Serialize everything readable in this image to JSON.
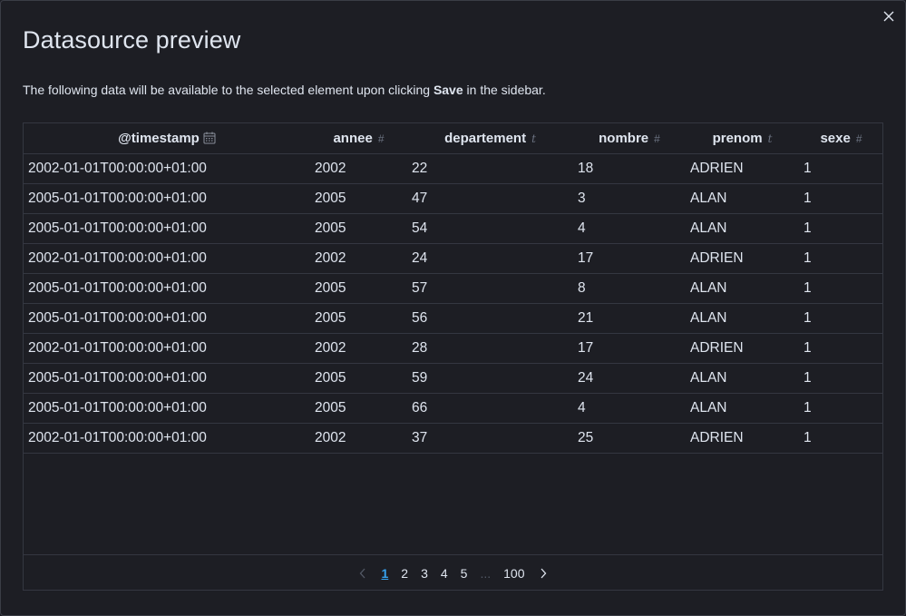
{
  "modal": {
    "title": "Datasource preview",
    "desc_before": "The following data will be available to the selected element upon clicking ",
    "desc_bold": "Save",
    "desc_after": " in the sidebar."
  },
  "table": {
    "columns": [
      {
        "label": "@timestamp",
        "type": "date"
      },
      {
        "label": "annee",
        "type": "#"
      },
      {
        "label": "departement",
        "type": "t"
      },
      {
        "label": "nombre",
        "type": "#"
      },
      {
        "label": "prenom",
        "type": "t"
      },
      {
        "label": "sexe",
        "type": "#"
      }
    ],
    "rows": [
      [
        "2002-01-01T00:00:00+01:00",
        "2002",
        "22",
        "18",
        "ADRIEN",
        "1"
      ],
      [
        "2005-01-01T00:00:00+01:00",
        "2005",
        "47",
        "3",
        "ALAN",
        "1"
      ],
      [
        "2005-01-01T00:00:00+01:00",
        "2005",
        "54",
        "4",
        "ALAN",
        "1"
      ],
      [
        "2002-01-01T00:00:00+01:00",
        "2002",
        "24",
        "17",
        "ADRIEN",
        "1"
      ],
      [
        "2005-01-01T00:00:00+01:00",
        "2005",
        "57",
        "8",
        "ALAN",
        "1"
      ],
      [
        "2005-01-01T00:00:00+01:00",
        "2005",
        "56",
        "21",
        "ALAN",
        "1"
      ],
      [
        "2002-01-01T00:00:00+01:00",
        "2002",
        "28",
        "17",
        "ADRIEN",
        "1"
      ],
      [
        "2005-01-01T00:00:00+01:00",
        "2005",
        "59",
        "24",
        "ALAN",
        "1"
      ],
      [
        "2005-01-01T00:00:00+01:00",
        "2005",
        "66",
        "4",
        "ALAN",
        "1"
      ],
      [
        "2002-01-01T00:00:00+01:00",
        "2002",
        "37",
        "25",
        "ADRIEN",
        "1"
      ]
    ]
  },
  "pagination": {
    "pages": [
      "1",
      "2",
      "3",
      "4",
      "5"
    ],
    "active": "1",
    "ellipsis": "...",
    "last": "100"
  },
  "icons": {
    "close": "close-icon",
    "calendar": "calendar-icon",
    "prev": "chevron-left-icon",
    "next": "chevron-right-icon"
  },
  "colors": {
    "background": "#1d1e24",
    "border": "#343741",
    "text": "#dfe5ef",
    "link_active": "#36a2ef",
    "muted": "#6c7382"
  }
}
